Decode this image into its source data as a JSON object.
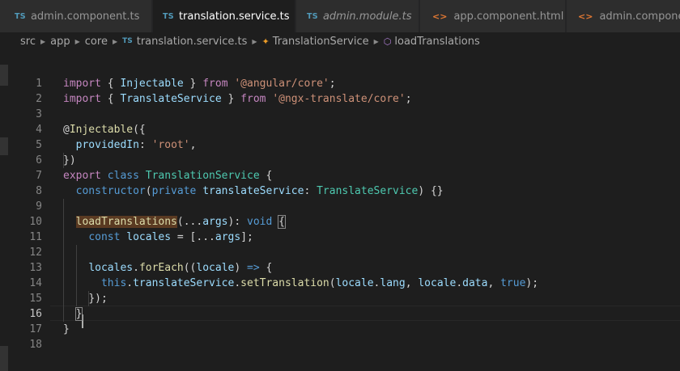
{
  "tabs": [
    {
      "icon": "TS",
      "label": "admin.component.ts",
      "active": false,
      "italic": false
    },
    {
      "icon": "TS",
      "label": "translation.service.ts",
      "active": true,
      "italic": false,
      "close": "×"
    },
    {
      "icon": "TS",
      "label": "admin.module.ts",
      "active": false,
      "italic": true
    },
    {
      "icon": "<>",
      "label": "app.component.html",
      "active": false,
      "italic": false
    },
    {
      "icon": "<>",
      "label": "admin.component.ts",
      "active": false,
      "italic": false
    }
  ],
  "breadcrumb": {
    "items": [
      "src",
      "app",
      "core"
    ],
    "file_icon": "TS",
    "file": "translation.service.ts",
    "class_icon": "class-icon",
    "class": "TranslationService",
    "method_icon": "method-icon",
    "method": "loadTranslations"
  },
  "editor": {
    "line_numbers": [
      "1",
      "2",
      "3",
      "4",
      "5",
      "6",
      "7",
      "8",
      "9",
      "10",
      "11",
      "12",
      "13",
      "14",
      "15",
      "16",
      "17",
      "18"
    ],
    "active_line": "16",
    "colors": {
      "keyword": "#569cd6",
      "control": "#c586c0",
      "string": "#ce9178",
      "variable": "#9cdcfe",
      "type": "#4ec9b0",
      "function": "#dcdcaa",
      "punctuation": "#d4d4d4"
    },
    "lines": [
      [
        {
          "t": "import",
          "c": "ctl"
        },
        {
          "t": " { ",
          "c": "pun"
        },
        {
          "t": "Injectable",
          "c": "id"
        },
        {
          "t": " } ",
          "c": "pun"
        },
        {
          "t": "from",
          "c": "ctl"
        },
        {
          "t": " ",
          "c": "pun"
        },
        {
          "t": "'@angular/core'",
          "c": "str"
        },
        {
          "t": ";",
          "c": "pun"
        }
      ],
      [
        {
          "t": "import",
          "c": "ctl"
        },
        {
          "t": " { ",
          "c": "pun"
        },
        {
          "t": "TranslateService",
          "c": "id"
        },
        {
          "t": " } ",
          "c": "pun"
        },
        {
          "t": "from",
          "c": "ctl"
        },
        {
          "t": " ",
          "c": "pun"
        },
        {
          "t": "'@ngx-translate/core'",
          "c": "str"
        },
        {
          "t": ";",
          "c": "pun"
        }
      ],
      [],
      [
        {
          "t": "@",
          "c": "pun"
        },
        {
          "t": "Injectable",
          "c": "fn"
        },
        {
          "t": "({",
          "c": "pun"
        }
      ],
      [
        {
          "t": "  ",
          "c": "pun"
        },
        {
          "t": "providedIn",
          "c": "id"
        },
        {
          "t": ": ",
          "c": "pun"
        },
        {
          "t": "'root'",
          "c": "str"
        },
        {
          "t": ",",
          "c": "pun"
        }
      ],
      [
        {
          "t": "})",
          "c": "pun"
        }
      ],
      [
        {
          "t": "export",
          "c": "ctl"
        },
        {
          "t": " ",
          "c": "pun"
        },
        {
          "t": "class",
          "c": "kw"
        },
        {
          "t": " ",
          "c": "pun"
        },
        {
          "t": "TranslationService",
          "c": "typ"
        },
        {
          "t": " {",
          "c": "pun"
        }
      ],
      [
        {
          "t": "  ",
          "c": "pun"
        },
        {
          "t": "constructor",
          "c": "kw"
        },
        {
          "t": "(",
          "c": "pun"
        },
        {
          "t": "private",
          "c": "kw"
        },
        {
          "t": " ",
          "c": "pun"
        },
        {
          "t": "translateService",
          "c": "id"
        },
        {
          "t": ": ",
          "c": "pun"
        },
        {
          "t": "TranslateService",
          "c": "typ"
        },
        {
          "t": ") {}",
          "c": "pun"
        }
      ],
      [],
      [
        {
          "t": "  ",
          "c": "pun"
        },
        {
          "t": "loadTranslations",
          "c": "fn",
          "hl": true
        },
        {
          "t": "(",
          "c": "pun"
        },
        {
          "t": "...",
          "c": "pun"
        },
        {
          "t": "args",
          "c": "id"
        },
        {
          "t": "): ",
          "c": "pun"
        },
        {
          "t": "void",
          "c": "kw"
        },
        {
          "t": " ",
          "c": "pun"
        },
        {
          "t": "{",
          "c": "pun",
          "box": true
        }
      ],
      [
        {
          "t": "    ",
          "c": "pun"
        },
        {
          "t": "const",
          "c": "kw"
        },
        {
          "t": " ",
          "c": "pun"
        },
        {
          "t": "locales",
          "c": "id"
        },
        {
          "t": " = [...",
          "c": "pun"
        },
        {
          "t": "args",
          "c": "id"
        },
        {
          "t": "];",
          "c": "pun"
        }
      ],
      [],
      [
        {
          "t": "    ",
          "c": "pun"
        },
        {
          "t": "locales",
          "c": "id"
        },
        {
          "t": ".",
          "c": "pun"
        },
        {
          "t": "forEach",
          "c": "fn"
        },
        {
          "t": "((",
          "c": "pun"
        },
        {
          "t": "locale",
          "c": "id"
        },
        {
          "t": ") ",
          "c": "pun"
        },
        {
          "t": "=>",
          "c": "kw"
        },
        {
          "t": " {",
          "c": "pun"
        }
      ],
      [
        {
          "t": "      ",
          "c": "pun"
        },
        {
          "t": "this",
          "c": "kw"
        },
        {
          "t": ".",
          "c": "pun"
        },
        {
          "t": "translateService",
          "c": "id"
        },
        {
          "t": ".",
          "c": "pun"
        },
        {
          "t": "setTranslation",
          "c": "fn"
        },
        {
          "t": "(",
          "c": "pun"
        },
        {
          "t": "locale",
          "c": "id"
        },
        {
          "t": ".",
          "c": "pun"
        },
        {
          "t": "lang",
          "c": "id"
        },
        {
          "t": ", ",
          "c": "pun"
        },
        {
          "t": "locale",
          "c": "id"
        },
        {
          "t": ".",
          "c": "pun"
        },
        {
          "t": "data",
          "c": "id"
        },
        {
          "t": ", ",
          "c": "pun"
        },
        {
          "t": "true",
          "c": "kw"
        },
        {
          "t": ");",
          "c": "pun"
        }
      ],
      [
        {
          "t": "    ",
          "c": "pun"
        },
        {
          "t": "});",
          "c": "pun"
        }
      ],
      [
        {
          "t": "  ",
          "c": "pun"
        },
        {
          "t": "}",
          "c": "pun",
          "box": true
        }
      ],
      [
        {
          "t": "}",
          "c": "pun"
        }
      ],
      []
    ]
  }
}
